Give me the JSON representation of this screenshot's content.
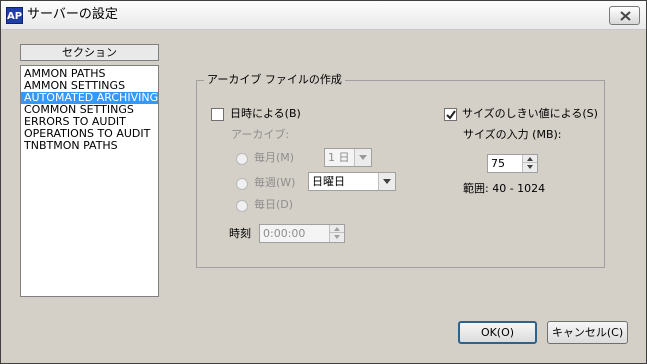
{
  "window": {
    "title": "サーバーの設定",
    "app_icon_text": "AP"
  },
  "sections": {
    "header": "セクション",
    "items": [
      "AMMON PATHS",
      "AMMON SETTINGS",
      "AUTOMATED ARCHIVING",
      "COMMON SETTINGS",
      "ERRORS TO AUDIT",
      "OPERATIONS TO AUDIT",
      "TNBTMON PATHS"
    ],
    "selected": "AUTOMATED ARCHIVING"
  },
  "archive_group": {
    "title": "アーカイブ ファイルの作成",
    "by_date": {
      "label": "日時による(B)",
      "checked": false
    },
    "archive_label": "アーカイブ:",
    "monthly": {
      "label": "毎月(M)",
      "selected": false,
      "combo_value": "1 日"
    },
    "weekly": {
      "label": "毎週(W)",
      "selected": false,
      "combo_value": "日曜日"
    },
    "daily": {
      "label": "毎日(D)",
      "selected": false
    },
    "time": {
      "label": "時刻",
      "value": "0:00:00"
    },
    "by_size": {
      "label": "サイズのしきい値による(S)",
      "checked": true
    },
    "size_input_label": "サイズの入力 (MB):",
    "size_value": "75",
    "range_text": "範囲: 40 - 1024"
  },
  "buttons": {
    "ok": "OK(O)",
    "cancel": "キャンセル(C)"
  },
  "colors": {
    "selection": "#3399ff",
    "dialog_bg": "#d4d0c8",
    "app_icon": "#1f3fa6"
  }
}
